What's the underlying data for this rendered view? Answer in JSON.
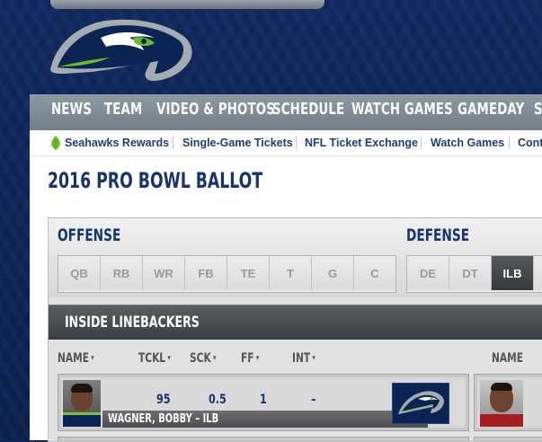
{
  "site": {
    "logo_icon": "seahawks-logo",
    "colors": {
      "navy": "#0b2454",
      "action_green": "#69be28",
      "wolf_grey": "#a5acaf",
      "dark_navy": "#163570"
    }
  },
  "main_nav": {
    "items": [
      "NEWS",
      "TEAM",
      "VIDEO & PHOTOS",
      "SCHEDULE",
      "WATCH GAMES",
      "GAMEDAY",
      "S"
    ]
  },
  "sub_nav": {
    "items": [
      {
        "label": "Seahawks Rewards",
        "icon": "leaf-icon"
      },
      {
        "label": "Single-Game Tickets"
      },
      {
        "label": "NFL Ticket Exchange"
      },
      {
        "label": "Watch Games"
      },
      {
        "label": "Cont"
      }
    ]
  },
  "page": {
    "title": "2016 PRO BOWL BALLOT"
  },
  "ballot": {
    "offense_label": "OFFENSE",
    "defense_label": "DEFENSE",
    "offense_positions": [
      "QB",
      "RB",
      "WR",
      "FB",
      "TE",
      "T",
      "G",
      "C"
    ],
    "defense_positions": [
      "DE",
      "DT",
      "ILB"
    ],
    "selected_position": "ILB",
    "section_title": "INSIDE LINEBACKERS",
    "columns": {
      "name": "NAME",
      "tckl": "TCKL",
      "sck": "SCK",
      "ff": "FF",
      "int": "INT",
      "name_right": "NAME"
    },
    "players": [
      {
        "name": "WAGNER, BOBBY – ILB",
        "tckl": "95",
        "sck": "0.5",
        "ff": "1",
        "int": "–",
        "team_icon": "seahawks-logo"
      }
    ]
  }
}
